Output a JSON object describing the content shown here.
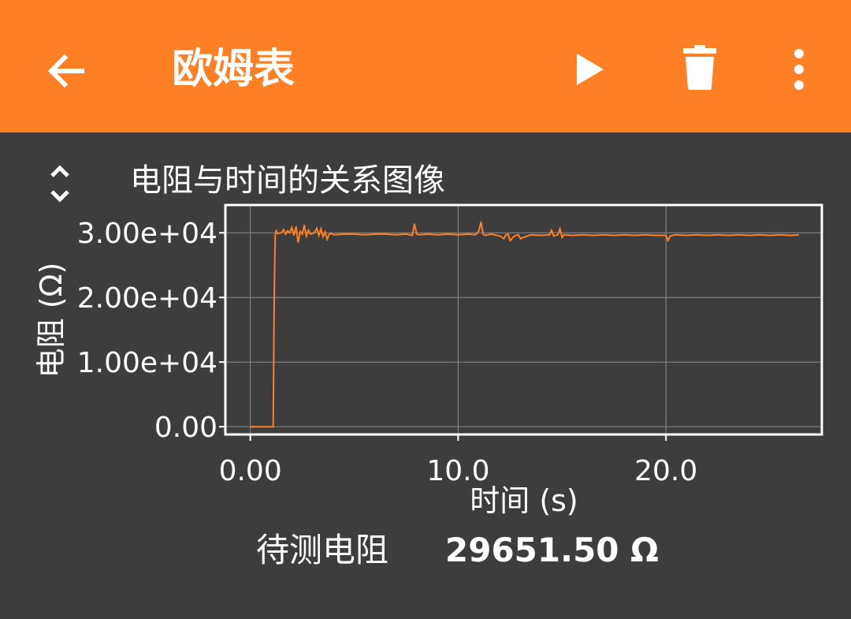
{
  "app_bar": {
    "title": "欧姆表",
    "background_color": "#ff7f24",
    "icons": [
      "back-arrow-icon",
      "play-icon",
      "delete-icon",
      "more-vert-icon"
    ]
  },
  "plot": {
    "title": "电阻与时间的关系图像",
    "switch_icon": "expand-collapse-icon"
  },
  "reading": {
    "label": "待测电阻",
    "value": "29651.50 Ω"
  },
  "colors": {
    "background": "#3d3d3d",
    "accent": "#ff7f24",
    "series": "#ff7f24",
    "grid": "#8a8a8a",
    "axes": "#ffffff"
  },
  "chart_data": {
    "type": "line",
    "title": "",
    "xlabel": "时间 (s)",
    "ylabel": "电阻 (Ω)",
    "xlim": [
      -1.2,
      27.5
    ],
    "ylim": [
      -1200,
      34300
    ],
    "x_ticks": [
      0,
      10,
      20
    ],
    "x_tick_labels": [
      "0.00",
      "10.0",
      "20.0"
    ],
    "y_ticks": [
      0,
      10000,
      20000,
      30000
    ],
    "y_tick_labels": [
      "0.00",
      "1.00e+04",
      "2.00e+04",
      "3.00e+04"
    ],
    "grid": true,
    "series": [
      {
        "x": [
          0,
          0.5,
          1.1,
          1.15,
          1.2,
          1.25,
          1.3,
          1.5,
          1.6,
          1.7,
          1.8,
          1.9,
          2.0,
          2.1,
          2.2,
          2.3,
          2.4,
          2.5,
          2.6,
          2.7,
          2.8,
          2.9,
          3.0,
          3.1,
          3.2,
          3.3,
          3.4,
          3.5,
          3.6,
          3.7,
          3.8,
          3.9,
          4.0,
          4.5,
          5.0,
          5.5,
          6.0,
          6.5,
          7.0,
          7.5,
          7.8,
          7.9,
          8.0,
          8.1,
          8.5,
          9.0,
          9.5,
          10.0,
          10.5,
          10.8,
          10.9,
          11.0,
          11.1,
          11.2,
          11.3,
          11.6,
          12.0,
          12.2,
          12.3,
          12.4,
          12.5,
          12.7,
          12.9,
          13.0,
          13.5,
          14.0,
          14.4,
          14.5,
          14.6,
          14.8,
          14.9,
          15.0,
          15.1,
          15.5,
          16.0,
          16.5,
          17.0,
          17.5,
          18.0,
          18.5,
          19.0,
          19.5,
          20.0,
          20.1,
          20.2,
          20.3,
          20.5,
          21.0,
          21.5,
          22.0,
          22.5,
          23.0,
          23.5,
          24.0,
          24.5,
          25.0,
          25.5,
          26.0,
          26.4
        ],
        "y": [
          0,
          0,
          0,
          20000,
          29800,
          30300,
          29900,
          30000,
          30500,
          29800,
          30300,
          30000,
          30800,
          29600,
          31000,
          28500,
          30200,
          29800,
          31200,
          29500,
          30400,
          29800,
          29900,
          30100,
          30700,
          29600,
          30600,
          29400,
          30100,
          29000,
          29800,
          29900,
          29700,
          29800,
          29800,
          29700,
          29800,
          29800,
          29700,
          29800,
          29600,
          31400,
          29800,
          29700,
          29800,
          29700,
          29800,
          29700,
          29800,
          29700,
          29900,
          30300,
          31700,
          29800,
          29600,
          29800,
          29500,
          29100,
          29700,
          29800,
          28800,
          29500,
          29700,
          29100,
          29700,
          29600,
          29700,
          30400,
          29500,
          29700,
          30600,
          29300,
          29700,
          29600,
          29700,
          29600,
          29700,
          29600,
          29700,
          29600,
          29700,
          29600,
          29600,
          28800,
          29500,
          29600,
          29700,
          29600,
          29700,
          29600,
          29700,
          29600,
          29700,
          29600,
          29700,
          29600,
          29700,
          29600,
          29700
        ]
      }
    ]
  }
}
